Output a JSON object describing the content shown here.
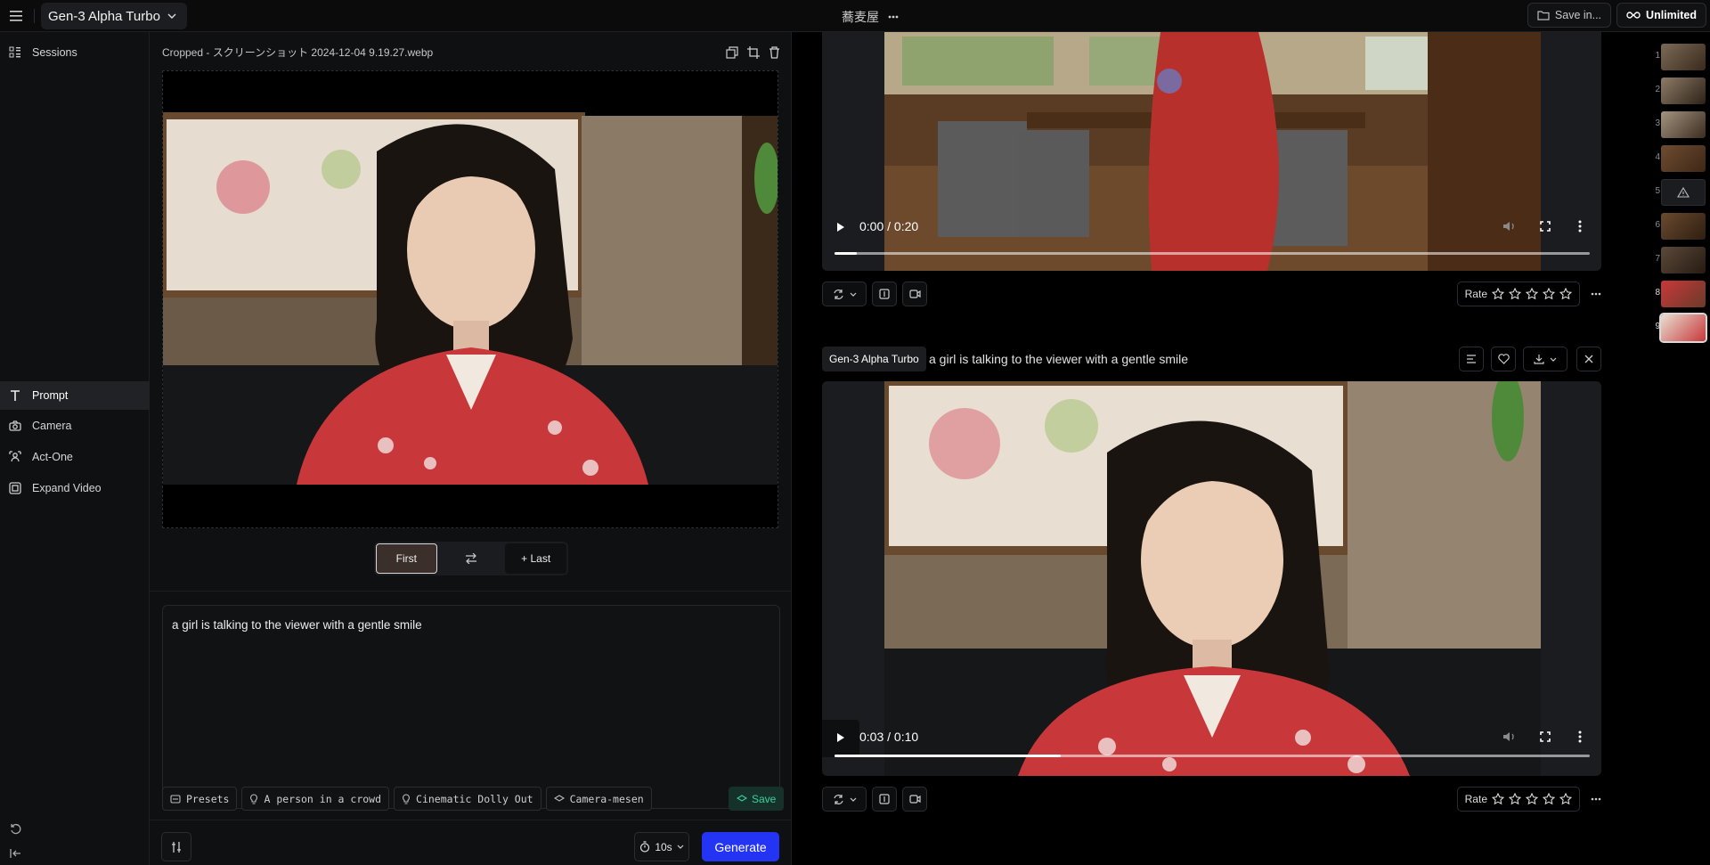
{
  "topbar": {
    "model": "Gen-3 Alpha Turbo",
    "title": "蕎麦屋",
    "save_label": "Save in...",
    "plan_label": "Unlimited"
  },
  "sidebar": {
    "items": [
      {
        "label": "Sessions",
        "icon": "grid-icon"
      },
      {
        "label": "Prompt",
        "icon": "text-icon"
      },
      {
        "label": "Camera",
        "icon": "camera-icon"
      },
      {
        "label": "Act-One",
        "icon": "act-one-icon"
      },
      {
        "label": "Expand Video",
        "icon": "expand-icon"
      }
    ],
    "active": "Prompt"
  },
  "composer": {
    "file_name": "Cropped - スクリーンショット 2024-12-04 9.19.27.webp",
    "first_label": "First",
    "last_label": "+ Last",
    "prompt_text": "a girl is talking to the viewer with a gentle smile",
    "chips": [
      "Presets",
      "A person in a crowd",
      "Cinematic Dolly Out",
      "Camera-mesen"
    ],
    "save_label": "Save",
    "duration": "10s",
    "generate_label": "Generate"
  },
  "feed": {
    "video1": {
      "time": "0:00 / 0:20",
      "progress": 0.03
    },
    "video2": {
      "model_badge": "Gen-3 Alpha Turbo",
      "prompt": "a girl is talking to the viewer with a gentle smile",
      "time": "0:03 / 0:10",
      "progress": 0.3
    },
    "rate_label": "Rate"
  },
  "thumbnails": [
    "1",
    "2",
    "3",
    "4",
    "5",
    "6",
    "7",
    "8",
    "9"
  ],
  "colors": {
    "accent": "#2334f5",
    "save_green": "#37d49c",
    "kimono_red": "#c8383a"
  }
}
